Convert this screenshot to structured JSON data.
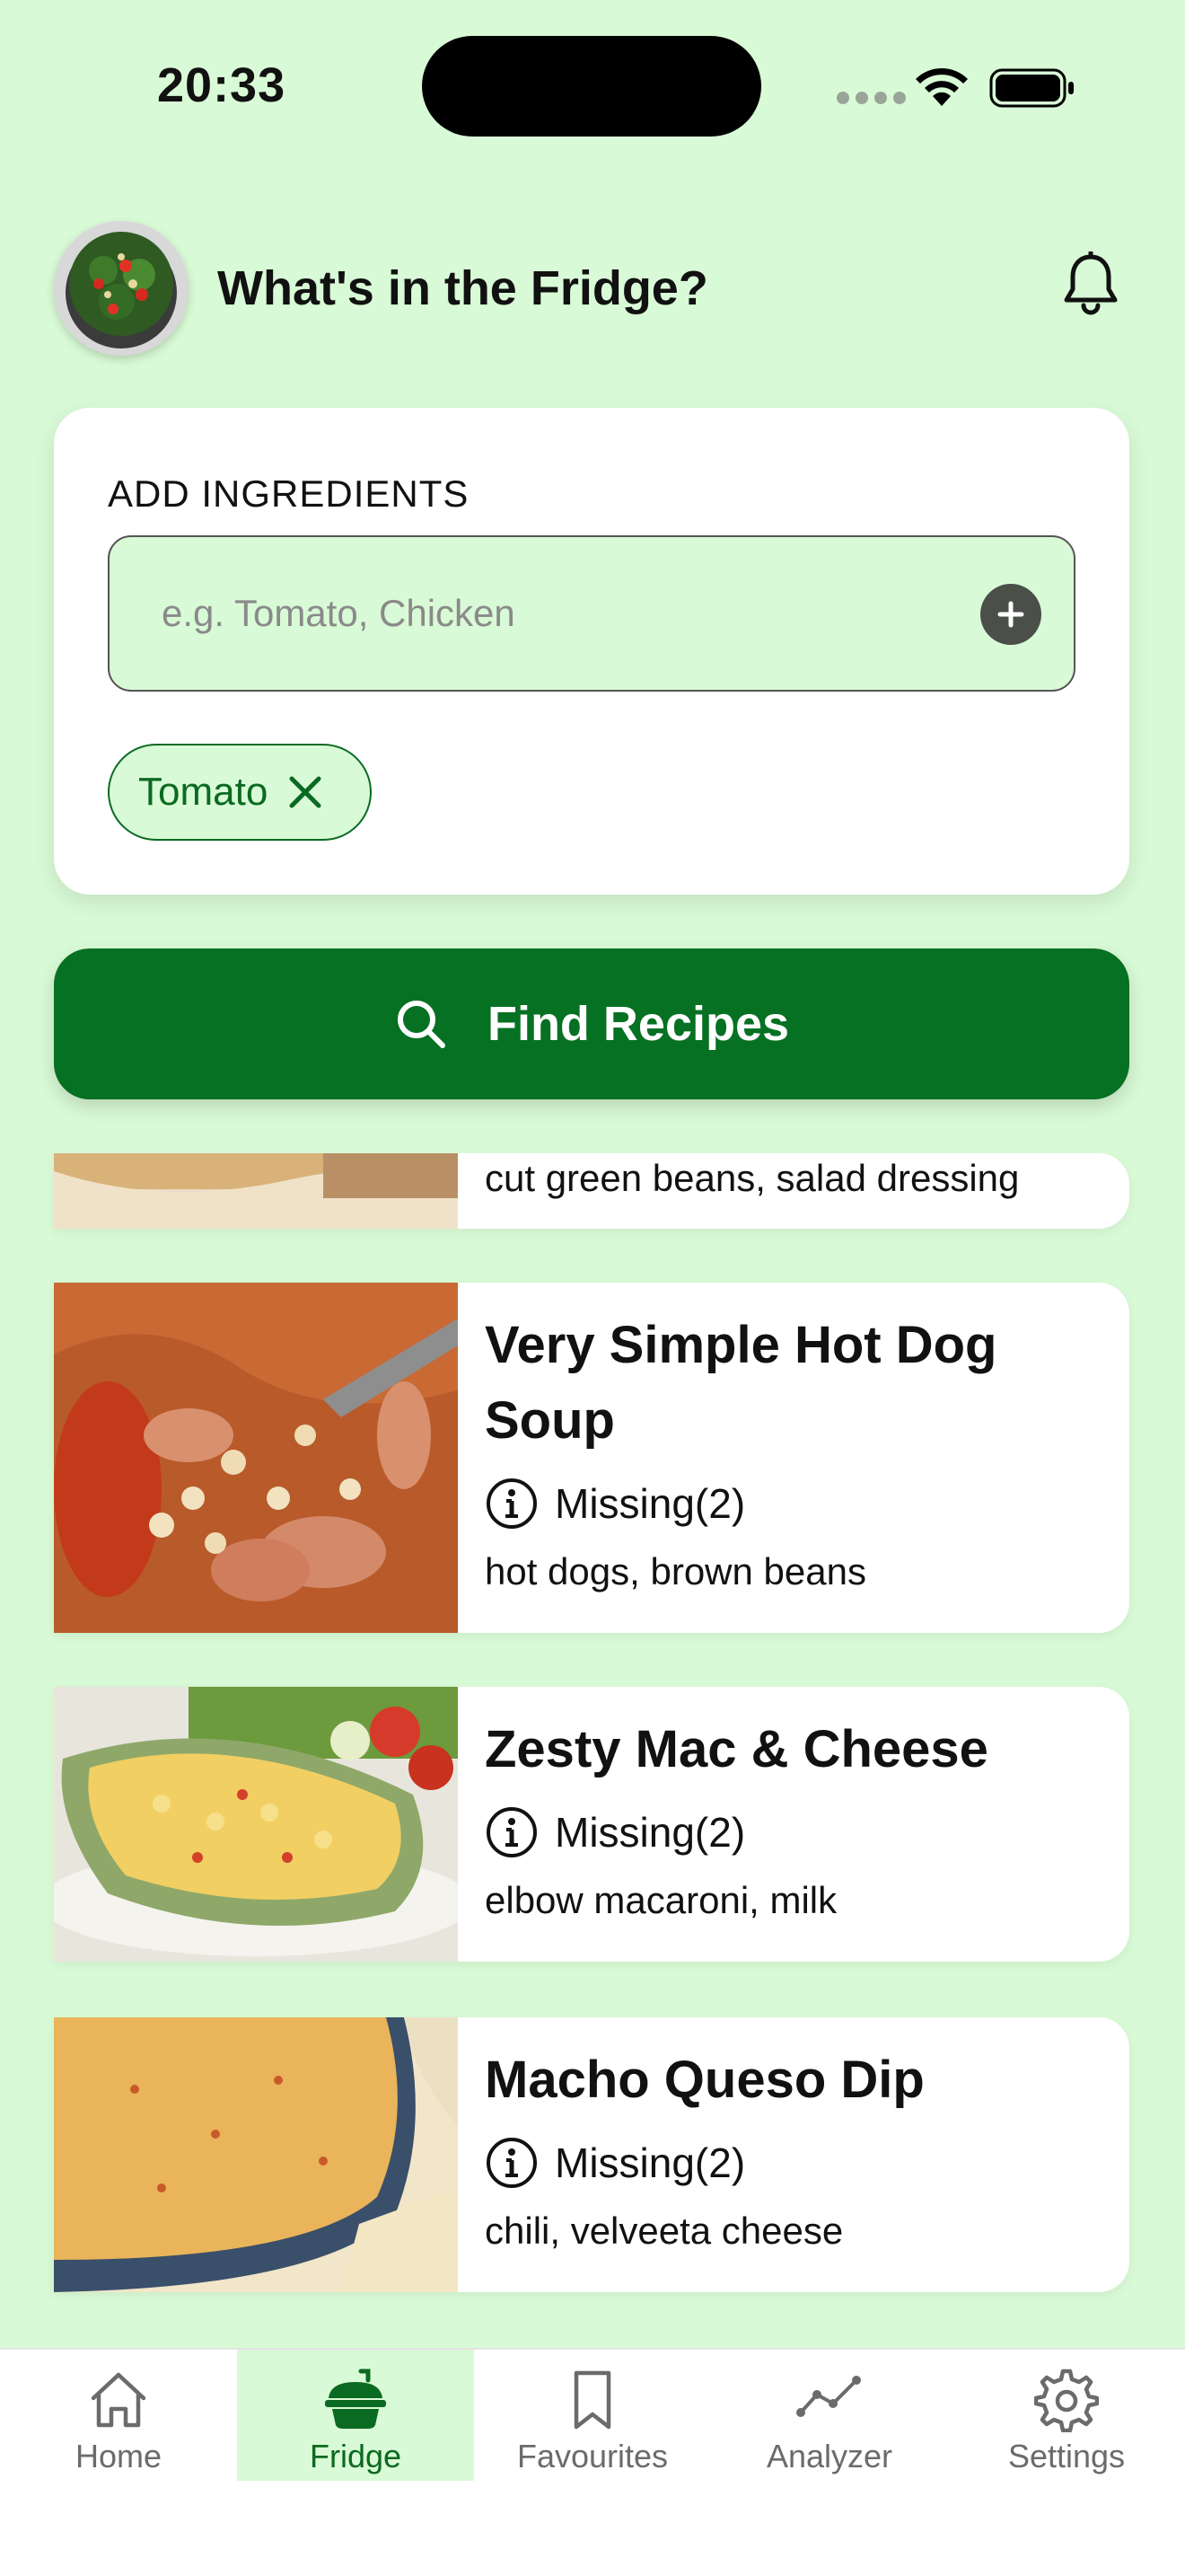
{
  "status_bar": {
    "time": "20:33"
  },
  "header": {
    "title": "What's in the Fridge?"
  },
  "ingredients_card": {
    "label": "ADD INGREDIENTS",
    "input_placeholder": "e.g. Tomato, Chicken",
    "input_value": "",
    "chips": [
      {
        "label": "Tomato"
      }
    ]
  },
  "find_button": {
    "label": "Find Recipes"
  },
  "recipes": [
    {
      "title": "",
      "missing_label": "",
      "missing_items": "cut green beans, salad dressing"
    },
    {
      "title": "Very Simple Hot Dog Soup",
      "missing_label": "Missing(2)",
      "missing_items": "hot dogs, brown beans"
    },
    {
      "title": "Zesty Mac & Cheese",
      "missing_label": "Missing(2)",
      "missing_items": "elbow macaroni, milk"
    },
    {
      "title": "Macho Queso Dip",
      "missing_label": "Missing(2)",
      "missing_items": "chili, velveeta cheese"
    }
  ],
  "tabbar": {
    "active": "Fridge",
    "items": [
      {
        "label": "Home",
        "icon": "house-icon"
      },
      {
        "label": "Fridge",
        "icon": "cooking-pot-icon"
      },
      {
        "label": "Favourites",
        "icon": "bookmark-icon"
      },
      {
        "label": "Analyzer",
        "icon": "trend-line-icon"
      },
      {
        "label": "Settings",
        "icon": "gear-icon"
      }
    ]
  },
  "colors": {
    "background": "#d9fad6",
    "primary": "#067122",
    "card": "#ffffff",
    "chip_text": "#0a6a21"
  }
}
